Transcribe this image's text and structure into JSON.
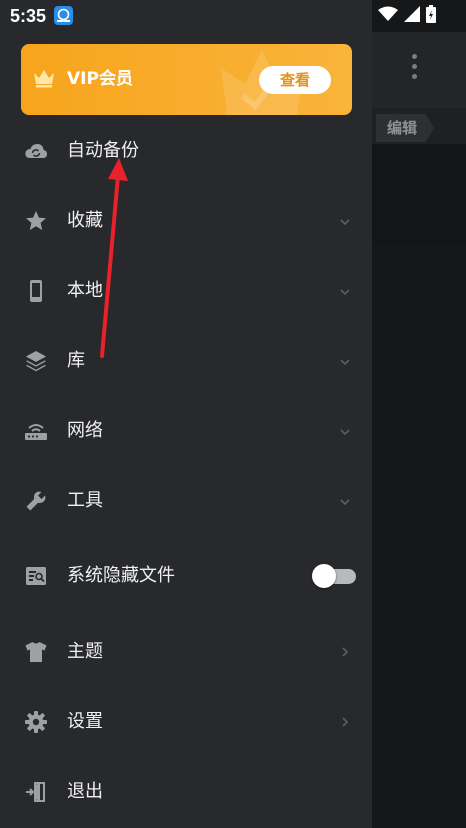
{
  "status_bar": {
    "time": "5:35"
  },
  "vip": {
    "label": "VIP会员",
    "button_label": "查看"
  },
  "menu": [
    {
      "label": "自动备份",
      "icon": "cloud-sync-icon",
      "control": "none"
    },
    {
      "label": "收藏",
      "icon": "star-icon",
      "control": "chevron-down"
    },
    {
      "label": "本地",
      "icon": "phone-icon",
      "control": "chevron-down"
    },
    {
      "label": "库",
      "icon": "layers-icon",
      "control": "chevron-down"
    },
    {
      "label": "网络",
      "icon": "router-icon",
      "control": "chevron-down"
    },
    {
      "label": "工具",
      "icon": "wrench-icon",
      "control": "chevron-down"
    },
    {
      "label": "系统隐藏文件",
      "icon": "hidden-file-icon",
      "control": "toggle",
      "toggle_on": false
    },
    {
      "label": "主题",
      "icon": "tshirt-icon",
      "control": "chevron-right"
    },
    {
      "label": "设置",
      "icon": "gear-icon",
      "control": "chevron-right"
    },
    {
      "label": "退出",
      "icon": "exit-icon",
      "control": "none"
    }
  ],
  "background_app": {
    "tab_label": "编辑"
  },
  "colors": {
    "accent": "#f7a41d",
    "drawer_bg": "#27292d",
    "arrow": "#e8212b"
  }
}
